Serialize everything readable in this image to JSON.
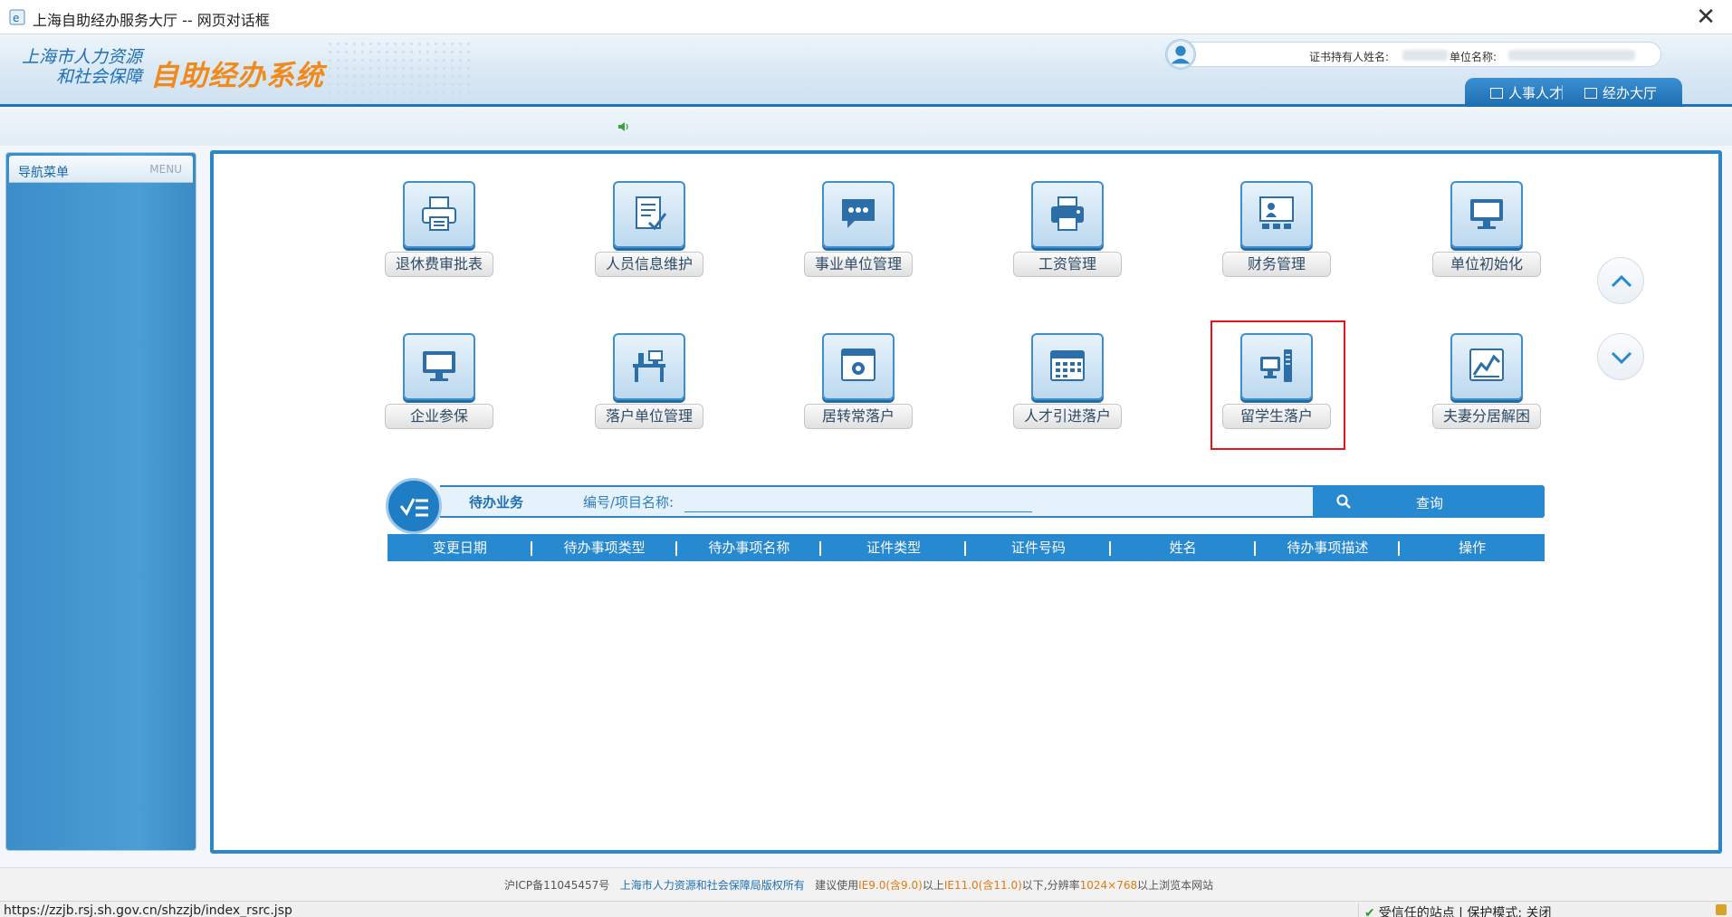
{
  "window": {
    "title": "上海自助经办服务大厅 -- 网页对话框",
    "close": "✕"
  },
  "header": {
    "logo_line1": "上海市人力资源",
    "logo_line2": "和社会保障",
    "logo_system": "自助经办系统",
    "cert_holder_label": "证书持有人姓名:",
    "unit_name_label": "单位名称:",
    "tabs": [
      {
        "label": "人事人才"
      },
      {
        "label": "经办大厅"
      }
    ]
  },
  "sidebar": {
    "title": "导航菜单",
    "menu": "MENU"
  },
  "tiles": [
    {
      "label": "退休费审批表",
      "icon": "printer-icon"
    },
    {
      "label": "人员信息维护",
      "icon": "document-edit-icon"
    },
    {
      "label": "事业单位管理",
      "icon": "chat-bubble-icon"
    },
    {
      "label": "工资管理",
      "icon": "printer-icon"
    },
    {
      "label": "财务管理",
      "icon": "presentation-icon"
    },
    {
      "label": "单位初始化",
      "icon": "monitor-icon"
    },
    {
      "label": "企业参保",
      "icon": "monitor-icon"
    },
    {
      "label": "落户单位管理",
      "icon": "desk-icon"
    },
    {
      "label": "居转常落户",
      "icon": "browser-gear-icon"
    },
    {
      "label": "人才引进落户",
      "icon": "calendar-icon"
    },
    {
      "label": "留学生落户",
      "icon": "desktop-computer-icon"
    },
    {
      "label": "夫妻分居解困",
      "icon": "chart-icon"
    }
  ],
  "todo": {
    "title": "待办业务",
    "field_label": "编号/项目名称:",
    "input_value": "",
    "search_label": "查询",
    "columns": [
      "变更日期",
      "待办事项类型",
      "待办事项名称",
      "证件类型",
      "证件号码",
      "姓名",
      "待办事项描述",
      "操作"
    ]
  },
  "footer": {
    "icp": "沪ICP备11045457号",
    "copyright": "上海市人力资源和社会保障局版权所有",
    "advice_1": "建议使用",
    "ie9": "IE9.0(含9.0)",
    "advice_2": "以上",
    "ie11": "IE11.0(含11.0)",
    "advice_3": "以下,分辨率",
    "resolution": "1024×768",
    "advice_4": "以上浏览本网站"
  },
  "status": {
    "url": "https://zzjb.rsj.sh.gov.cn/shzzjb/index_rsrc.jsp",
    "trusted": "受信任的站点 | 保护模式: 关闭"
  }
}
